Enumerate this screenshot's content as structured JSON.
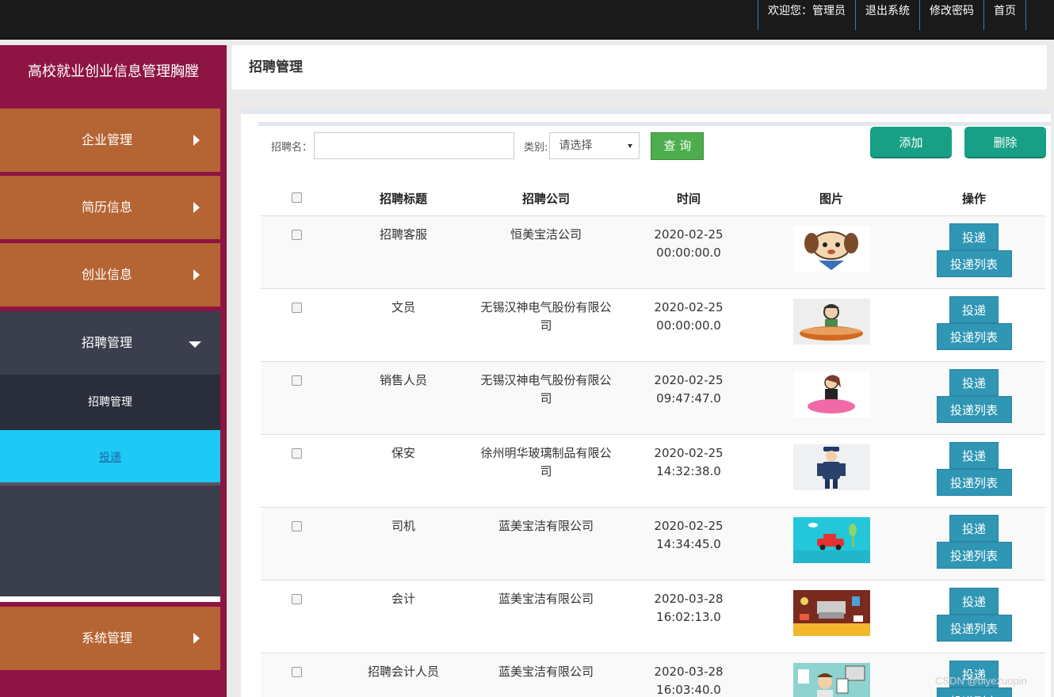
{
  "topnav": [
    "欢迎您：管理员",
    "退出系统",
    "修改密码",
    "首页"
  ],
  "sidebar": {
    "title": "高校就业创业信息管理胸膛",
    "items": [
      {
        "label": "企业管理"
      },
      {
        "label": "简历信息"
      },
      {
        "label": "创业信息"
      },
      {
        "label": "招聘管理"
      },
      {
        "label": "系统管理"
      }
    ],
    "sub_items": [
      {
        "label": "招聘管理"
      },
      {
        "label": "投递"
      }
    ]
  },
  "header": {
    "title": "招聘管理"
  },
  "search": {
    "name_label": "招聘名：",
    "name_value": "",
    "type_label": "类别:",
    "type_selected": "请选择",
    "query_label": "查 询"
  },
  "actions": {
    "add_label": "添加",
    "delete_label": "删除"
  },
  "table": {
    "headers": [
      "招聘标题",
      "招聘公司",
      "时间",
      "图片",
      "操作"
    ],
    "rows": [
      {
        "title": "招聘客服",
        "company": "恒美宝洁公司",
        "date": "2020-02-25",
        "time": "00:00:00.0"
      },
      {
        "title": "文员",
        "company": "无锡汉神电气股份有限公司",
        "date": "2020-02-25",
        "time": "00:00:00.0"
      },
      {
        "title": "销售人员",
        "company": "无锡汉神电气股份有限公司",
        "date": "2020-02-25",
        "time": "09:47:47.0"
      },
      {
        "title": "保安",
        "company": "徐州明华玻璃制品有限公司",
        "date": "2020-02-25",
        "time": "14:32:38.0"
      },
      {
        "title": "司机",
        "company": "蓝美宝洁有限公司",
        "date": "2020-02-25",
        "time": "14:34:45.0"
      },
      {
        "title": "会计",
        "company": "蓝美宝洁有限公司",
        "date": "2020-03-28",
        "time": "16:02:13.0"
      },
      {
        "title": "招聘会计人员",
        "company": "蓝美宝洁有限公司",
        "date": "2020-03-28",
        "time": "16:03:40.0"
      }
    ],
    "op_apply": "投递",
    "op_list": "投递列表"
  },
  "watermark": "CSDN @biyezuopin",
  "colors": {
    "sidebar_bg": "#8e1444",
    "menu_item": "#b56433",
    "active_sub": "#1dc9f5",
    "green_button": "#17a085",
    "blue_button": "#2f96b4"
  }
}
